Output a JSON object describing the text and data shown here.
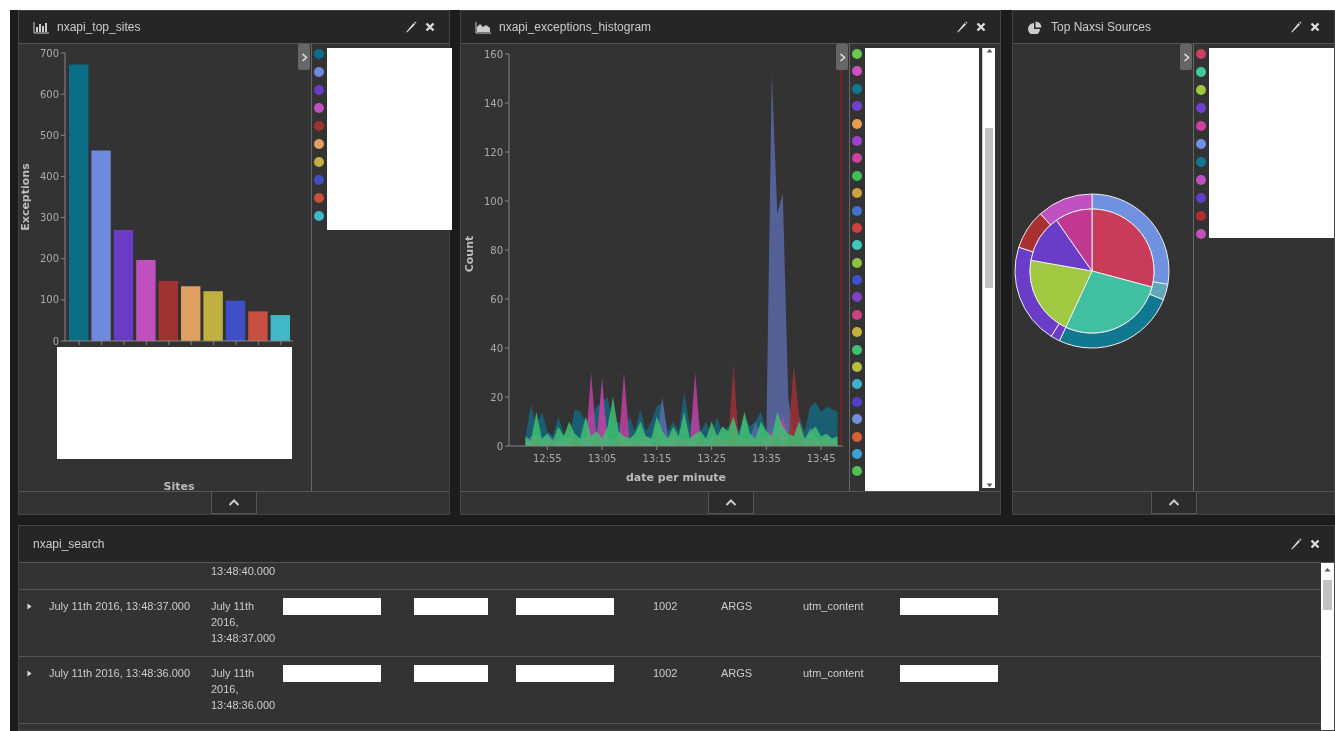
{
  "panels": [
    {
      "kind": "bar",
      "title": "nxapi_top_sites",
      "legend": {
        "items": [
          {
            "color": "#0b6e87"
          },
          {
            "color": "#7088dd"
          },
          {
            "color": "#6a3bc4"
          },
          {
            "color": "#c04fc0"
          },
          {
            "color": "#a03232"
          },
          {
            "color": "#e0a060"
          },
          {
            "color": "#c0b040"
          },
          {
            "color": "#3f4fc8"
          },
          {
            "color": "#c85040"
          },
          {
            "color": "#40b8c8"
          }
        ],
        "redacted": true
      },
      "axis_labels_redacted": true,
      "chart_data": {
        "type": "bar",
        "xlabel": "Sites",
        "ylabel": "Exceptions",
        "values": [
          672,
          463,
          270,
          197,
          146,
          133,
          121,
          98,
          72,
          63
        ],
        "ylim": [
          0,
          700
        ],
        "yticks": [
          0,
          100,
          200,
          300,
          400,
          500,
          600,
          700
        ]
      }
    },
    {
      "kind": "area",
      "title": "nxapi_exceptions_histogram",
      "legend": {
        "items": [
          {
            "color": "#6bc84a"
          },
          {
            "color": "#d050c0"
          },
          {
            "color": "#107890"
          },
          {
            "color": "#7040d0"
          },
          {
            "color": "#e8a050"
          },
          {
            "color": "#a040d0"
          },
          {
            "color": "#d040a0"
          },
          {
            "color": "#40c050"
          },
          {
            "color": "#d0a040"
          },
          {
            "color": "#4070d0"
          },
          {
            "color": "#d04040"
          },
          {
            "color": "#40c8c0"
          },
          {
            "color": "#90c040"
          },
          {
            "color": "#4050d0"
          },
          {
            "color": "#8040c8"
          },
          {
            "color": "#d04080"
          },
          {
            "color": "#c8b040"
          },
          {
            "color": "#40c070"
          },
          {
            "color": "#b8c040"
          },
          {
            "color": "#40b0d0"
          },
          {
            "color": "#5040c8"
          },
          {
            "color": "#7090e0"
          },
          {
            "color": "#d86030"
          },
          {
            "color": "#40a0d0"
          },
          {
            "color": "#50c050"
          }
        ],
        "redacted": true,
        "scrollable": true
      },
      "chart_data": {
        "type": "area",
        "xlabel": "date per minute",
        "ylabel": "Count",
        "ylim": [
          0,
          160
        ],
        "yticks": [
          0,
          20,
          40,
          60,
          80,
          100,
          120,
          140,
          160
        ],
        "x": [
          771,
          772,
          773,
          774,
          775,
          776,
          777,
          778,
          779,
          780,
          781,
          782,
          783,
          784,
          785,
          786,
          787,
          788,
          789,
          790,
          791,
          792,
          793,
          794,
          795,
          796,
          797,
          798,
          799,
          800,
          801,
          802,
          803,
          804,
          805,
          806,
          807,
          808,
          809,
          810,
          811,
          812,
          813,
          814,
          815,
          816,
          817,
          818,
          819,
          820,
          821,
          822,
          823,
          824,
          825,
          826,
          827,
          828
        ],
        "xlim": [
          768,
          829
        ],
        "xticks": [
          {
            "value": 775,
            "label": "12:55"
          },
          {
            "value": 785,
            "label": "13:05"
          },
          {
            "value": 795,
            "label": "13:15"
          },
          {
            "value": 805,
            "label": "13:25"
          },
          {
            "value": 815,
            "label": "13:35"
          },
          {
            "value": 825,
            "label": "13:45"
          }
        ],
        "series": [
          {
            "color": "#15667c",
            "values": [
              3,
              17,
              8,
              14,
              6,
              4,
              12,
              5,
              3,
              15,
              14,
              10,
              12,
              16,
              18,
              20,
              8,
              10,
              5,
              12,
              6,
              15,
              6,
              10,
              16,
              18,
              6,
              10,
              6,
              22,
              8,
              16,
              6,
              10,
              4,
              12,
              5,
              8,
              10,
              6,
              12,
              8,
              10,
              14,
              6,
              8,
              10,
              8,
              10,
              5,
              12,
              6,
              16,
              18,
              14,
              16,
              15,
              14
            ]
          },
          {
            "color": "#5a6aa8",
            "values": [
              2,
              4,
              3,
              2,
              5,
              3,
              2,
              4,
              3,
              2,
              3,
              4,
              2,
              3,
              24,
              3,
              2,
              4,
              3,
              2,
              3,
              2,
              4,
              3,
              2,
              20,
              4,
              2,
              3,
              2,
              3,
              4,
              2,
              3,
              2,
              4,
              3,
              2,
              3,
              4,
              2,
              3,
              10,
              4,
              3,
              152,
              95,
              103,
              20,
              4,
              3,
              2,
              8,
              3,
              2,
              4,
              3,
              2
            ]
          },
          {
            "color": "#c040a0",
            "values": [
              0,
              2,
              5,
              0,
              3,
              0,
              2,
              0,
              4,
              2,
              3,
              0,
              30,
              2,
              28,
              0,
              3,
              0,
              30,
              2,
              0,
              4,
              2,
              0,
              3,
              0,
              2,
              5,
              2,
              3,
              0,
              30,
              2,
              0,
              4,
              0,
              3,
              2,
              5,
              0,
              3,
              2,
              0,
              4,
              2,
              6,
              3,
              12,
              4,
              2,
              0,
              3,
              2,
              4,
              0,
              3,
              2,
              0
            ]
          },
          {
            "color": "#a03038",
            "values": [
              0,
              0,
              3,
              0,
              0,
              2,
              0,
              0,
              0,
              4,
              0,
              0,
              0,
              2,
              0,
              0,
              0,
              3,
              0,
              0,
              2,
              0,
              0,
              0,
              3,
              0,
              0,
              0,
              2,
              0,
              0,
              0,
              4,
              0,
              0,
              5,
              0,
              0,
              33,
              0,
              2,
              0,
              0,
              3,
              0,
              0,
              4,
              0,
              2,
              33,
              12,
              0,
              2,
              0,
              3,
              0,
              2,
              0
            ]
          },
          {
            "color": "#40c070",
            "values": [
              4,
              2,
              14,
              3,
              5,
              2,
              8,
              4,
              10,
              5,
              3,
              12,
              4,
              6,
              3,
              8,
              20,
              6,
              4,
              3,
              5,
              10,
              4,
              3,
              12,
              6,
              3,
              8,
              4,
              14,
              3,
              5,
              6,
              3,
              10,
              4,
              8,
              6,
              12,
              4,
              14,
              5,
              3,
              10,
              6,
              4,
              14,
              8,
              5,
              4,
              10,
              3,
              6,
              8,
              4,
              5,
              3,
              4
            ]
          }
        ]
      }
    },
    {
      "kind": "pie",
      "title": "Top Naxsi Sources",
      "legend": {
        "items": [
          {
            "color": "#c84060"
          },
          {
            "color": "#40c8a0"
          },
          {
            "color": "#a0c840"
          },
          {
            "color": "#7040d0"
          },
          {
            "color": "#d040a0"
          },
          {
            "color": "#7090e0"
          },
          {
            "color": "#107890"
          },
          {
            "color": "#c050c0"
          },
          {
            "color": "#6040c8"
          },
          {
            "color": "#b03030"
          },
          {
            "color": "#c050c0"
          }
        ],
        "redacted": true
      }
    }
  ],
  "search": {
    "title": "nxapi_search",
    "rows": [
      {
        "expander": false,
        "cells": {
          "column_2": "13:48:40.000"
        }
      },
      {
        "expander": true,
        "cells": {
          "column_1": "July 11th 2016, 13:48:37.000",
          "column_2": "July 11th 2016, 13:48:37.000",
          "column_3": {
            "kind": "redacted"
          },
          "column_4": {
            "kind": "redacted"
          },
          "column_5": {
            "kind": "redacted"
          },
          "column_6": "1002",
          "column_7": "ARGS",
          "column_8": "utm_content",
          "column_9": {
            "kind": "redacted"
          }
        }
      },
      {
        "expander": true,
        "cells": {
          "column_1": "July 11th 2016, 13:48:36.000",
          "column_2": "July 11th 2016, 13:48:36.000",
          "column_3": {
            "kind": "redacted"
          },
          "column_4": {
            "kind": "redacted"
          },
          "column_5": {
            "kind": "redacted"
          },
          "column_6": "1002",
          "column_7": "ARGS",
          "column_8": "utm_content",
          "column_9": {
            "kind": "redacted"
          }
        }
      }
    ]
  }
}
